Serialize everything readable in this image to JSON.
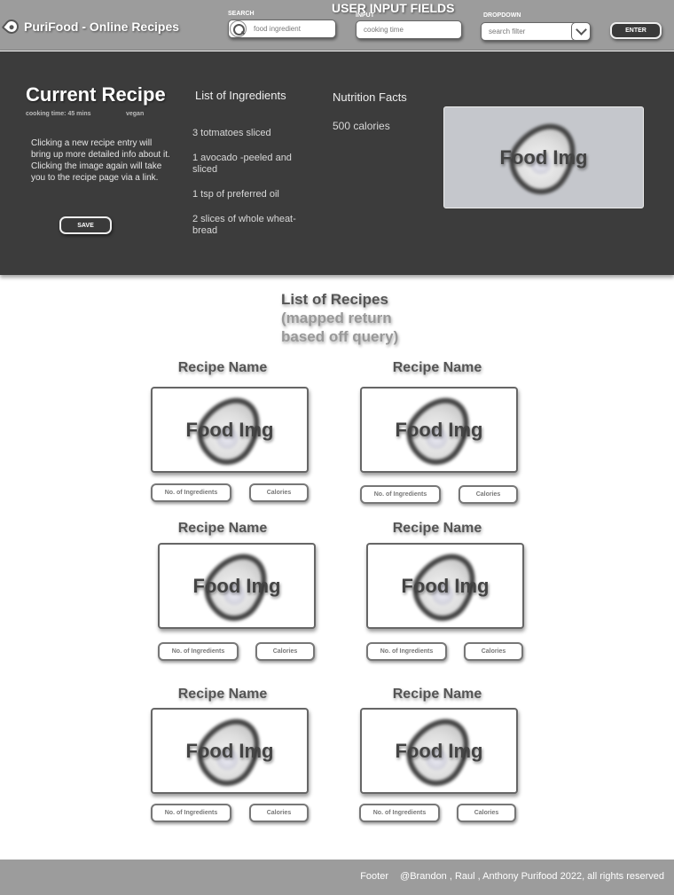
{
  "header": {
    "brand_name": "PuriFood - Online Recipes",
    "logo_icon": "avocado-icon",
    "fields_title": "USER INPUT FIELDS",
    "search": {
      "label": "SEARCH",
      "placeholder": "food ingredient"
    },
    "input": {
      "label": "INPUT",
      "placeholder": "cooking time"
    },
    "dropdown": {
      "label": "DROPDOWN",
      "selected": "search filter"
    },
    "enter_label": "ENTER"
  },
  "current_recipe": {
    "title": "Current Recipe",
    "cooking_time": "cooking time: 45 mins",
    "diet": "vegan",
    "description": "Clicking a new recipe entry will bring up  more detailed info about it. Clicking the image again will take you to the recipe page via a link.",
    "save_label": "SAVE",
    "ingredients_title": "List of Ingredients",
    "ingredients": [
      "3 totmatoes sliced",
      "1 avocado -peeled and sliced",
      "1 tsp of preferred oil",
      "2 slices of whole wheat-bread"
    ],
    "nutrition_title": "Nutrition Facts",
    "nutrition_value": "500 calories",
    "image_label": "Food Img"
  },
  "recipe_list": {
    "title": "List of Recipes",
    "subtitle": "(mapped return based off query)",
    "recipes": [
      {
        "name": "Recipe Name",
        "image_label": "Food Img",
        "ingredients_label": "No. of Ingredients",
        "calories_label": "Calories"
      },
      {
        "name": "Recipe Name",
        "image_label": "Food Img",
        "ingredients_label": "No. of Ingredients",
        "calories_label": "Calories"
      },
      {
        "name": "Recipe Name",
        "image_label": "Food Img",
        "ingredients_label": "No. of Ingredients",
        "calories_label": "Calories"
      },
      {
        "name": "Recipe Name",
        "image_label": "Food Img",
        "ingredients_label": "No. of Ingredients",
        "calories_label": "Calories"
      },
      {
        "name": "Recipe Name",
        "image_label": "Food Img",
        "ingredients_label": "No. of Ingredients",
        "calories_label": "Calories"
      },
      {
        "name": "Recipe Name",
        "image_label": "Food Img",
        "ingredients_label": "No. of Ingredients",
        "calories_label": "Calories"
      }
    ]
  },
  "footer": {
    "label": "Footer",
    "credits": "@Brandon , Raul , Anthony Purifood 2022, all rights reserved"
  },
  "colors": {
    "topbar": "#9c9c9c",
    "panel": "#3c3c3c",
    "footer": "#9c9c9c",
    "image_placeholder": "#c5c7cc"
  }
}
